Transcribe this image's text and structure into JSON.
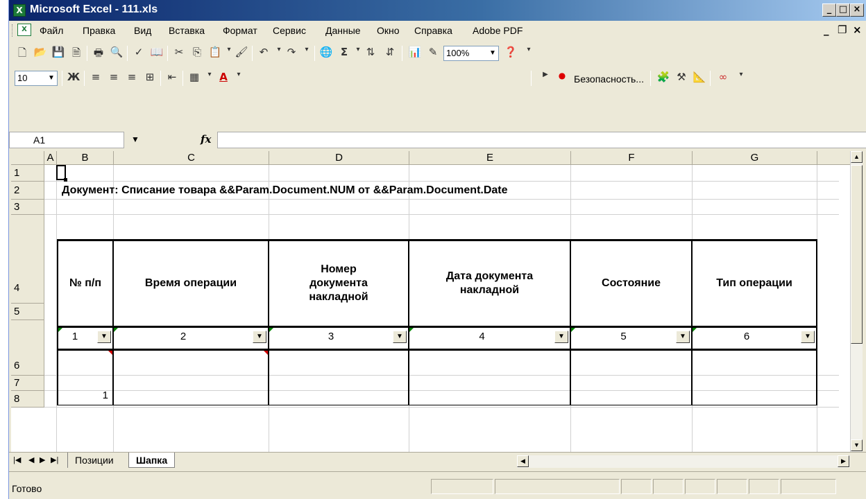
{
  "window": {
    "title": "Microsoft Excel - 111.xls"
  },
  "menu": [
    "Файл",
    "Правка",
    "Вид",
    "Вставка",
    "Формат",
    "Сервис",
    "Данные",
    "Окно",
    "Справка",
    "Adobe PDF"
  ],
  "toolbar": {
    "zoom": "100%",
    "font_size": "10",
    "security_label": "Безопасность..."
  },
  "formula_bar": {
    "name_box": "A1",
    "formula": ""
  },
  "columns": [
    "A",
    "B",
    "C",
    "D",
    "E",
    "F",
    "G"
  ],
  "rows": [
    "1",
    "2",
    "3",
    "4",
    "5",
    "6",
    "7",
    "8"
  ],
  "sheet": {
    "title": "Документ: Списание товара &&Param.Document.NUM от &&Param.Document.Date",
    "table_headers": [
      "№ п/п",
      "Время операции",
      "Номер документа накладной",
      "Дата документа накладной",
      "Состояние",
      "Тип операции"
    ],
    "column_numbers": [
      "1",
      "2",
      "3",
      "4",
      "5",
      "6"
    ],
    "row6_value": "1"
  },
  "tabs": [
    "Позиции",
    "Шапка"
  ],
  "active_tab": "Шапка",
  "status": "Готово",
  "colors": {
    "title_bar_start": "#0a246a",
    "title_bar_end": "#a6caf0",
    "chrome": "#ece9d8",
    "excel_green": "#1d7b3a"
  }
}
